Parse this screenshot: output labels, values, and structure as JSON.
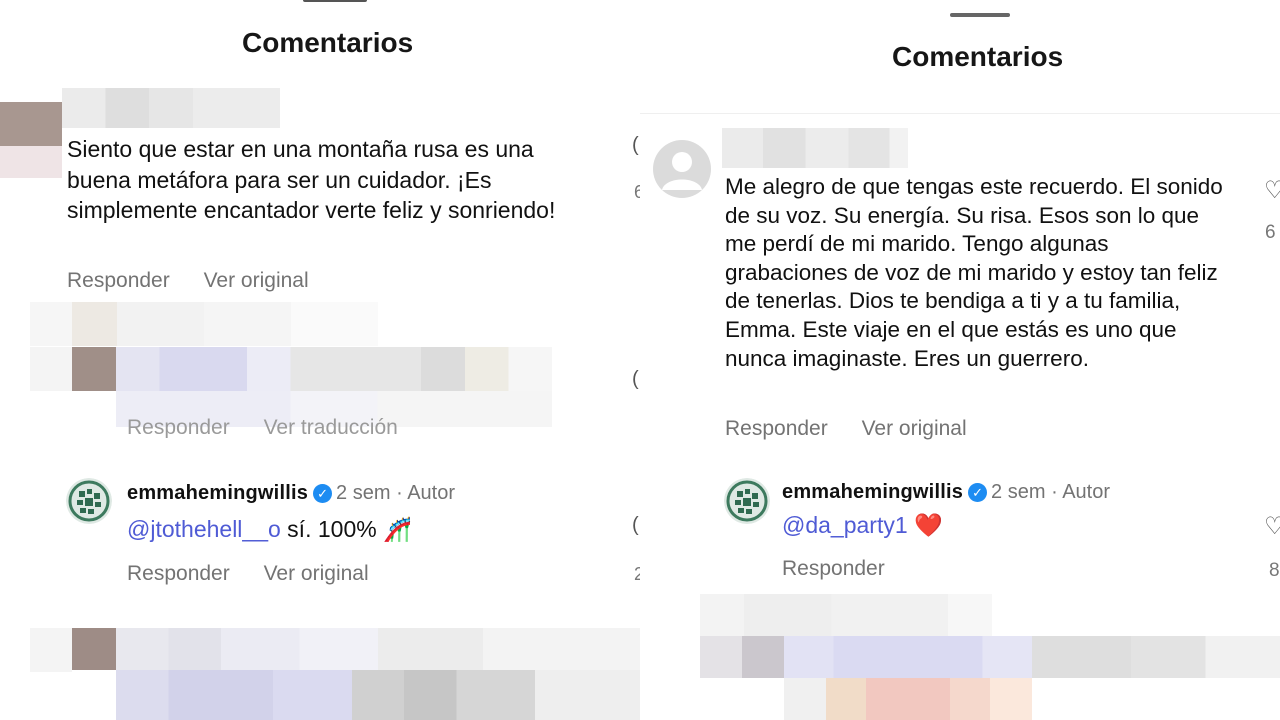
{
  "left": {
    "header": {
      "title": "Comentarios"
    },
    "comment1": {
      "text": "Siento que estar en una montaña rusa es una buena metáfora para ser un cuidador. ¡Es simplemente encantador verte feliz y sonriendo!",
      "reply_label": "Responder",
      "see_original_label": "Ver original"
    },
    "hidden_comment": {
      "reply_label": "Responder",
      "translation_label": "Ver traducción"
    },
    "author_reply": {
      "username": "emmahemingwillis",
      "time": "2 sem",
      "badge": "Autor",
      "mention": "@jtothehell__o",
      "text": " sí. 100% 🎢",
      "reply_label": "Responder",
      "see_original_label": "Ver original"
    }
  },
  "right": {
    "header": {
      "title": "Comentarios"
    },
    "comment1": {
      "text": "Me alegro de que tengas este recuerdo. El sonido de su voz. Su energía. Su risa. Esos son lo que me perdí de mi marido. Tengo algunas grabaciones de voz de mi marido y estoy tan feliz de tenerlas. Dios te bendiga a ti y a tu familia, Emma. Este viaje en el que estás es uno que nunca imaginaste. Eres un guerrero.",
      "reply_label": "Responder",
      "see_original_label": "Ver original",
      "like_count_partial": "6"
    },
    "author_reply": {
      "username": "emmahemingwillis",
      "time": "2 sem",
      "badge": "Autor",
      "mention": "@da_party1",
      "text": " ❤️",
      "reply_label": "Responder",
      "like_count_partial": "8"
    }
  },
  "icons": {
    "verified": "verified-badge-icon",
    "like": "heart-icon",
    "default_avatar": "user-silhouette-icon"
  },
  "colors": {
    "mention": "#4f5bd5",
    "verified": "#1d8cf2",
    "secondary_text": "#737373"
  }
}
